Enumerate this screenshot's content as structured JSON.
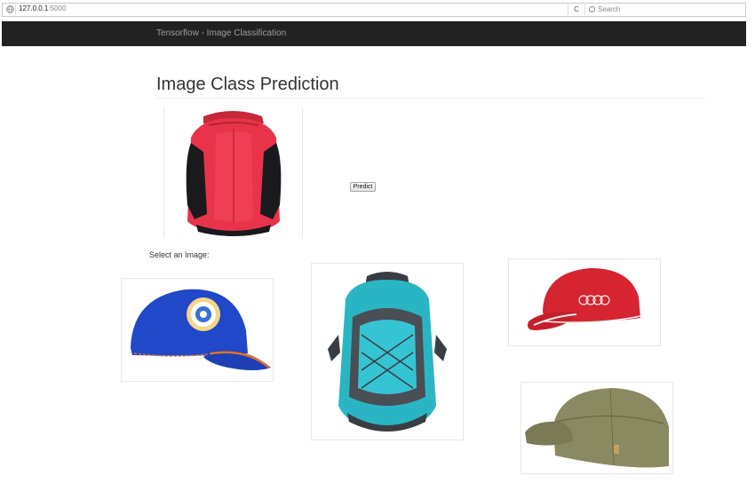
{
  "browser": {
    "url_host": "127.0.0.1",
    "url_port": ":5000",
    "search_placeholder": "Search",
    "reload_glyph": "C"
  },
  "navbar": {
    "brand": "Tensorflow - Image Classification"
  },
  "main": {
    "title": "Image Class Prediction",
    "predict_label": "Predict",
    "select_label": "Select an Image:"
  },
  "images": {
    "preview": "red-backpack",
    "gallery": [
      "blue-cap",
      "teal-backpack",
      "red-audi-cap",
      "olive-cap"
    ]
  },
  "colors": {
    "navbar_bg": "#222222",
    "brand_text": "#9d9d9d"
  }
}
